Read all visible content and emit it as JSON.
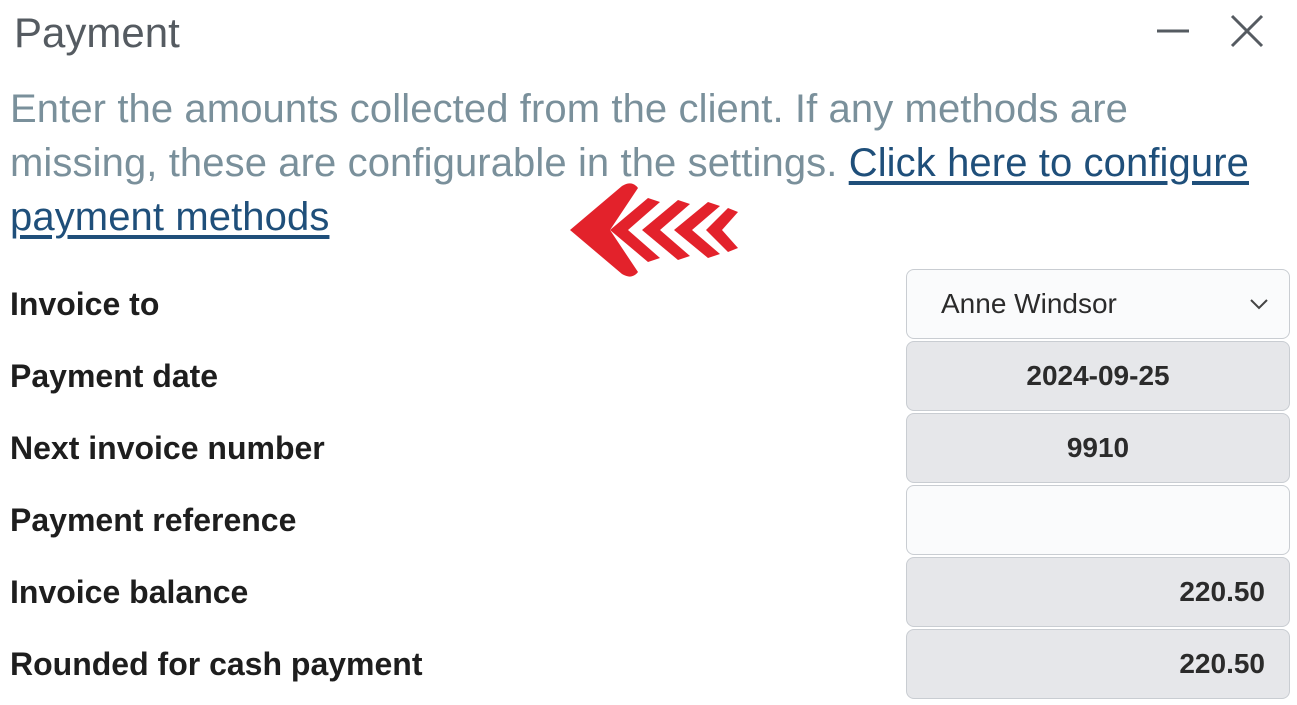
{
  "window": {
    "title": "Payment"
  },
  "intro": {
    "text": "Enter the amounts collected from the client. If any methods are missing, these are configurable in the settings. ",
    "link": "Click here to configure payment methods"
  },
  "form": {
    "invoice_to": {
      "label": "Invoice to",
      "value": "Anne Windsor"
    },
    "payment_date": {
      "label": "Payment date",
      "value": "2024-09-25"
    },
    "next_invoice_number": {
      "label": "Next invoice number",
      "value": "9910"
    },
    "payment_reference": {
      "label": "Payment reference",
      "value": "",
      "placeholder": ""
    },
    "invoice_balance": {
      "label": "Invoice balance",
      "value": "220.50"
    },
    "rounded_cash": {
      "label": "Rounded for cash payment",
      "value": "220.50"
    }
  },
  "colors": {
    "arrow": "#e3222b",
    "link": "#1f4f7a",
    "intro_text": "#7a909b",
    "readonly_bg": "#e6e7ea"
  },
  "icons": {
    "minimize": "minimize-icon",
    "close": "close-icon",
    "dropdown": "chevron-down-icon",
    "pointer": "red-arrow-pointer-icon"
  }
}
